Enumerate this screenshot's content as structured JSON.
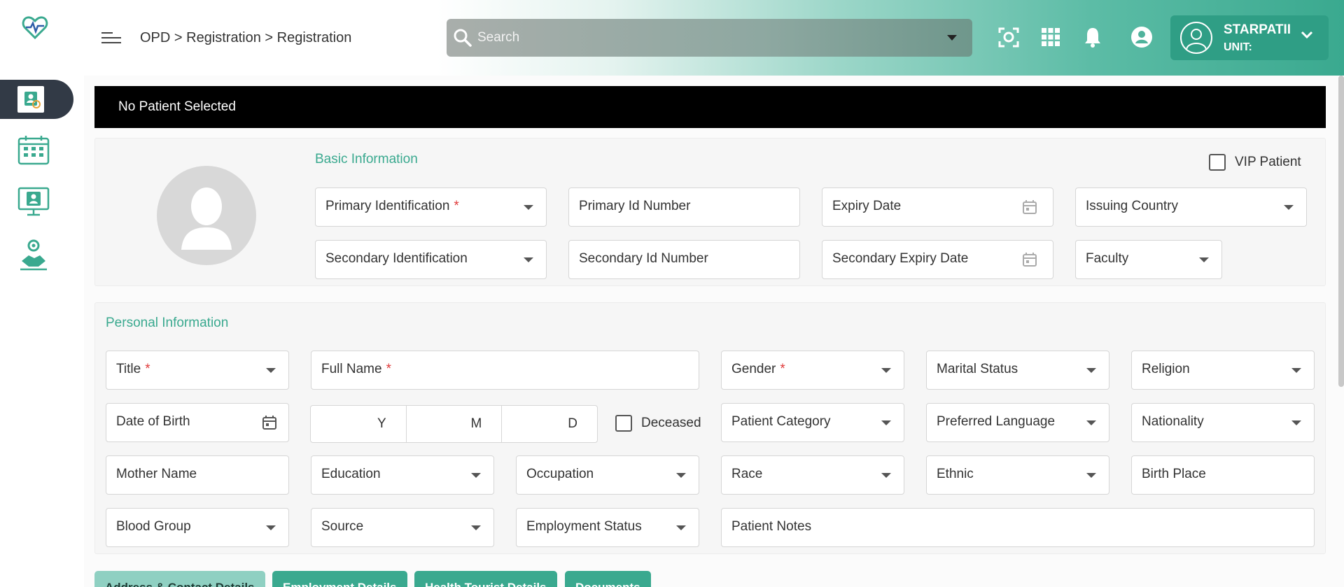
{
  "header": {
    "breadcrumb": "OPD > Registration > Registration",
    "search_placeholder": "Search",
    "user_name": "STARPATII",
    "unit_label": "UNIT:"
  },
  "patient_bar": {
    "text": "No Patient Selected"
  },
  "basic_info": {
    "title": "Basic Information",
    "vip_label": "VIP Patient",
    "fields": {
      "primary_identification": "Primary Identification",
      "primary_id_number": "Primary Id Number",
      "expiry_date": "Expiry Date",
      "issuing_country": "Issuing Country",
      "secondary_identification": "Secondary Identification",
      "secondary_id_number": "Secondary Id Number",
      "secondary_expiry_date": "Secondary Expiry Date",
      "faculty": "Faculty"
    }
  },
  "personal_info": {
    "title": "Personal Information",
    "fields": {
      "title": "Title",
      "full_name": "Full Name",
      "gender": "Gender",
      "marital_status": "Marital Status",
      "religion": "Religion",
      "date_of_birth": "Date of Birth",
      "age_y": "Y",
      "age_m": "M",
      "age_d": "D",
      "deceased": "Deceased",
      "patient_category": "Patient Category",
      "preferred_language": "Preferred Language",
      "nationality": "Nationality",
      "mother_name": "Mother Name",
      "education": "Education",
      "occupation": "Occupation",
      "race": "Race",
      "ethnic": "Ethnic",
      "birth_place": "Birth Place",
      "blood_group": "Blood Group",
      "source": "Source",
      "employment_status": "Employment Status",
      "patient_notes": "Patient Notes"
    },
    "required_mark": "*"
  },
  "tabs": [
    {
      "label": "Address & Contact Details"
    },
    {
      "label": "Employment Details"
    },
    {
      "label": "Health Tourist Details"
    },
    {
      "label": "Documents"
    }
  ],
  "colors": {
    "accent": "#3aa98f",
    "sidebar_active": "#323a46",
    "required": "#e03a3a"
  }
}
